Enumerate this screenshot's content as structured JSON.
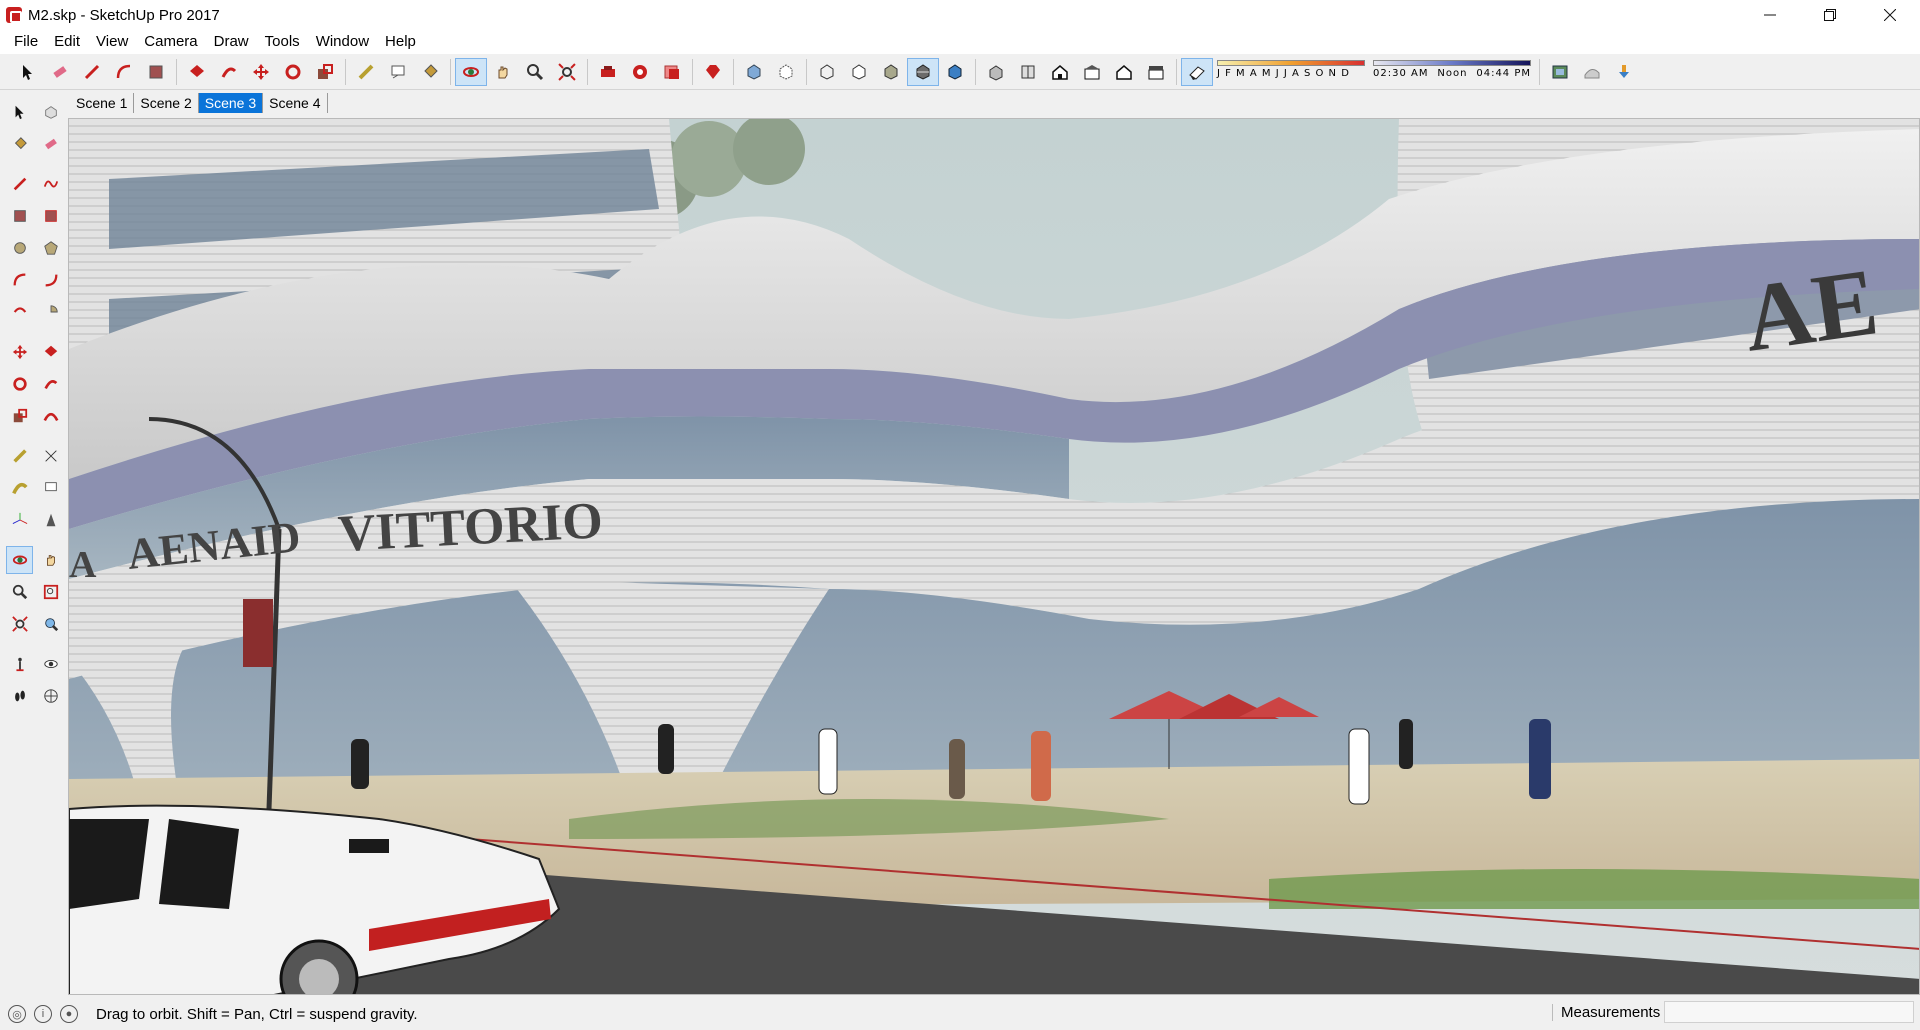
{
  "window": {
    "title": "M2.skp - SketchUp Pro 2017",
    "app_icon": "sketchup-icon",
    "controls": [
      "minimize",
      "restore",
      "close"
    ]
  },
  "menu": [
    "File",
    "Edit",
    "View",
    "Camera",
    "Draw",
    "Tools",
    "Window",
    "Help"
  ],
  "toolbar": {
    "groups": [
      [
        "select-icon",
        "eraser-icon",
        "line-icon",
        "arc-icon",
        "shape-icon"
      ],
      [
        "push-pull-icon",
        "follow-me-icon",
        "move-icon",
        "rotate-icon",
        "scale-icon"
      ],
      [
        "tape-measure-icon",
        "text-icon",
        "paint-bucket-icon"
      ],
      [
        "orbit-icon",
        "pan-icon",
        "zoom-icon",
        "zoom-extents-icon"
      ],
      [
        "warehouse-icon",
        "extension-warehouse-icon",
        "layout-icon"
      ],
      [
        "ruby-icon"
      ],
      [
        "xray-icon",
        "back-edges-icon"
      ],
      [
        "wireframe-icon",
        "hidden-line-icon",
        "shaded-icon",
        "shaded-textures-icon",
        "monochrome-icon"
      ],
      [
        "iso-view-icon",
        "top-view-icon",
        "front-view-icon",
        "right-view-icon",
        "back-view-icon",
        "left-view-icon"
      ],
      [
        "shadows-icon"
      ]
    ],
    "active": [
      "orbit-icon",
      "shaded-textures-icon",
      "shadows-icon"
    ],
    "shadow_months": "J F M A M J J A S O N D",
    "shadow_time_start": "02:30 AM",
    "shadow_time_mid": "Noon",
    "shadow_time_end": "04:44 PM",
    "extra_icons": [
      "geo-location-icon",
      "sandbox-icon",
      "import-icon"
    ]
  },
  "left_toolbar": [
    [
      "select-icon",
      "component-icon"
    ],
    [
      "paint-bucket-icon",
      "eraser-icon"
    ],
    [
      "line-icon",
      "freehand-icon"
    ],
    [
      "rectangle-icon",
      "rotated-rectangle-icon"
    ],
    [
      "circle-icon",
      "polygon-icon"
    ],
    [
      "arc-icon",
      "two-point-arc-icon"
    ],
    [
      "three-point-arc-icon",
      "pie-icon"
    ],
    [
      "move-icon",
      "push-pull-icon"
    ],
    [
      "rotate-icon",
      "follow-me-icon"
    ],
    [
      "scale-icon",
      "offset-icon"
    ],
    [
      "tape-measure-icon",
      "dimension-icon"
    ],
    [
      "protractor-icon",
      "text-icon"
    ],
    [
      "axes-icon",
      "3d-text-icon"
    ],
    [
      "orbit-icon",
      "pan-icon"
    ],
    [
      "zoom-icon",
      "zoom-window-icon"
    ],
    [
      "zoom-extents-icon",
      "previous-view-icon"
    ],
    [
      "position-camera-icon",
      "look-around-icon"
    ],
    [
      "walk-icon",
      "section-plane-icon"
    ]
  ],
  "left_toolbar_active": "orbit-icon",
  "scenes": [
    "Scene 1",
    "Scene 2",
    "Scene 3",
    "Scene 4"
  ],
  "active_scene": 2,
  "signage": {
    "left_sign": "AENAID",
    "left_sign_partial": "A",
    "center_sign": "VITTORIO",
    "right_sign": "AE"
  },
  "status": {
    "hint": "Drag to orbit. Shift = Pan, Ctrl = suspend gravity.",
    "measurements_label": "Measurements",
    "measurements_value": ""
  },
  "colors": {
    "accent_blue": "#0a74d9",
    "sketchup_red": "#c8201f",
    "building": "#dcdcdc",
    "glass": "#8aa0b4",
    "sky": "#c7d4d4"
  }
}
